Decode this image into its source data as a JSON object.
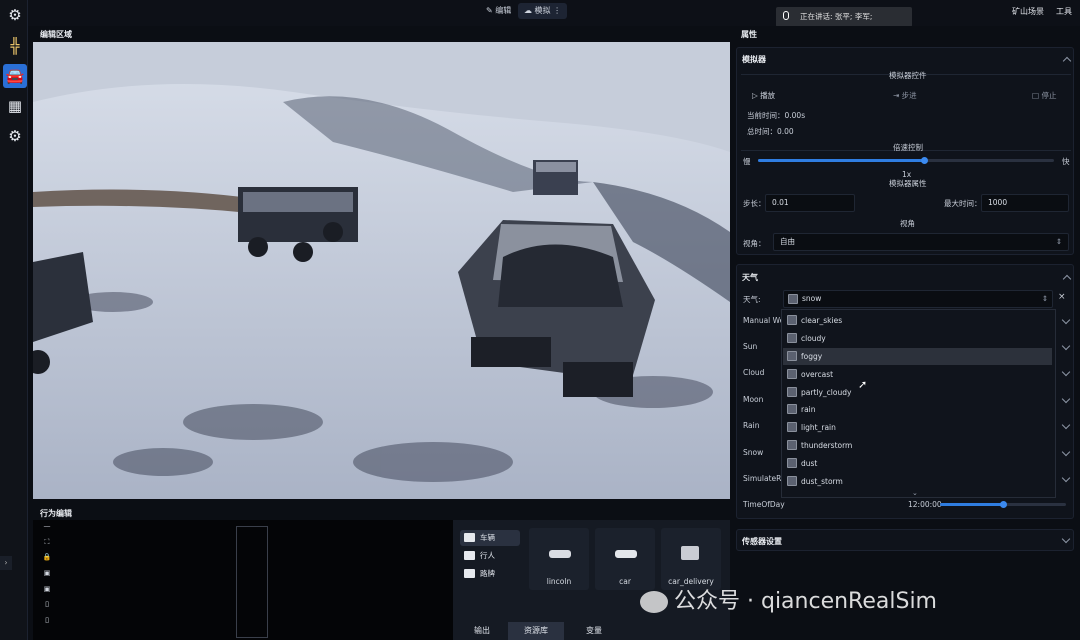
{
  "sidebar": {
    "icons": [
      "gears-icon",
      "road-icon",
      "vehicles-icon",
      "grid-icon",
      "settings-icon"
    ]
  },
  "topbar": {
    "edit_tab": "编辑",
    "sim_tab": "模拟",
    "scene": "矿山场景",
    "tools": "工具"
  },
  "speaking": {
    "text": "正在讲话: 张平; 李军;"
  },
  "viewport": {
    "title": "编辑区域"
  },
  "behavior": {
    "title": "行为编辑"
  },
  "assets": {
    "folders": [
      "车辆",
      "行人",
      "路牌"
    ],
    "items": [
      "lincoln",
      "car",
      "car_delivery"
    ],
    "tabs": [
      "输出",
      "资源库",
      "变量"
    ]
  },
  "props": {
    "title": "属性",
    "simulator": {
      "title": "模拟器",
      "controls_title": "模拟器控件",
      "play": "播放",
      "step": "步进",
      "stop": "停止",
      "current_time": "当前时间：0.00s",
      "total_time": "总时间：0.00",
      "speed_title": "倍速控制",
      "slow": "慢",
      "fast": "快",
      "speed_value": "1x",
      "speed_fraction": 0.56,
      "attr_title": "模拟器属性",
      "step_label": "步长：",
      "step_value": "0.01",
      "max_time_label": "最大时间：",
      "max_time_value": "1000",
      "view_title": "视角",
      "view_label": "视角：",
      "view_value": "自由"
    },
    "weather": {
      "title": "天气",
      "weather_label": "天气:",
      "weather_value": "snow",
      "rows": [
        "Manual We",
        "Sun",
        "Cloud",
        "Moon",
        "Rain",
        "Snow",
        "SimulateRe"
      ],
      "options": [
        "clear_skies",
        "cloudy",
        "foggy",
        "overcast",
        "partly_cloudy",
        "rain",
        "light_rain",
        "thunderstorm",
        "dust",
        "dust_storm"
      ],
      "highlighted": "foggy",
      "time_label": "TimeOfDay",
      "time_value": "12:00:00",
      "time_fraction": 0.5
    },
    "sensor": {
      "title": "传感器设置"
    }
  },
  "watermark": "公众号 · qiancenRealSim"
}
